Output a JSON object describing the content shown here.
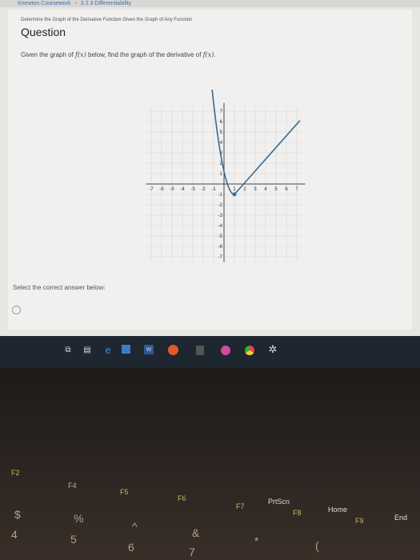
{
  "breadcrumb": {
    "course": "Knewton Coursework",
    "separator": "›",
    "section": "3.2.3 Differentiability"
  },
  "question": {
    "subtitle": "Determine the Graph of the Derivative Function Given the Graph of Any Function",
    "title": "Question",
    "prompt_before": "Given the graph of ",
    "fx": "f(x)",
    "prompt_middle": " below, find the graph of the derivative of ",
    "fx2": "f(x)",
    "prompt_end": "."
  },
  "graph": {
    "x_ticks": [
      "-7",
      "-6",
      "-5",
      "-4",
      "-3",
      "-2",
      "-1",
      "1",
      "2",
      "3",
      "4",
      "5",
      "6",
      "7"
    ],
    "y_ticks_pos": [
      "7",
      "6",
      "5",
      "4",
      "3",
      "2",
      "1"
    ],
    "y_ticks_neg": [
      "-1",
      "-2",
      "-3",
      "-4",
      "-5",
      "-6",
      "-7"
    ],
    "point": {
      "x": 1,
      "y": -1
    }
  },
  "answer": {
    "select_label": "Select the correct answer below:"
  },
  "taskbar": {
    "icons": [
      "task-view-icon",
      "edge-icon",
      "file-explorer-icon",
      "store-icon",
      "word-icon",
      "calculator-icon",
      "itunes-icon",
      "chrome-icon",
      "settings-icon"
    ]
  },
  "keyboard": {
    "labels": {
      "prtscn": "PrtScn",
      "home": "Home",
      "end": "End"
    },
    "fkeys": {
      "f2": "F2",
      "f4": "F4",
      "f5": "F5",
      "f6": "F6",
      "f7": "F7",
      "f8": "F8",
      "f9": "F9"
    },
    "chars": {
      "dollar": "$",
      "four": "4",
      "percent": "%",
      "five": "5",
      "caret": "^",
      "six": "6",
      "amp": "&",
      "seven": "7",
      "star": "*",
      "paren": "("
    }
  }
}
